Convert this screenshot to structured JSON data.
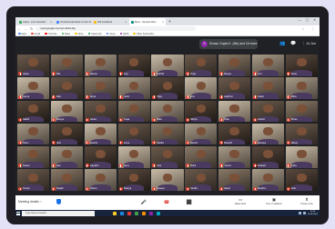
{
  "browser": {
    "tabs": [
      {
        "title": "Lafiya - Link Guardian",
        "favicon_color": "#34a853",
        "active": false
      },
      {
        "title": "Vivekananda Matric Hr.Sec.Sch",
        "favicon_color": "#4285f4",
        "active": false
      },
      {
        "title": "AW Feedback",
        "favicon_color": "#fbbc04",
        "active": false
      },
      {
        "title": "Meet - Sample Meet",
        "favicon_color": "#00897b",
        "active": true
      }
    ],
    "new_tab": "+",
    "window_controls": "— ▢ ✕",
    "url": "meet.google.com/xyz-abcd-efg",
    "nav": {
      "back": "←",
      "forward": "→",
      "reload": "↻"
    },
    "toolbar_icons": "☆ ⋮",
    "bookmarks": [
      {
        "label": "Apps",
        "color": "#4285f4"
      },
      {
        "label": "Gmail",
        "color": "#ea4335"
      },
      {
        "label": "YouTube",
        "color": "#ff0000"
      },
      {
        "label": "Maps",
        "color": "#34a853"
      },
      {
        "label": "Drive",
        "color": "#fbbc04"
      },
      {
        "label": "Classroom",
        "color": "#0f9d58"
      },
      {
        "label": "News",
        "color": "#4285f4"
      },
      {
        "label": "EMIS",
        "color": "#9c27b0"
      },
      {
        "label": "Other bookmarks",
        "color": "#fbbc04"
      }
    ]
  },
  "meet": {
    "pinned": {
      "initial": "S",
      "name": "Sivasu Gupta K. (Me) and 16 more"
    },
    "top_icons": {
      "people": "👥",
      "chat": "💬",
      "count": "⋮ 14 Jun"
    },
    "participants": [
      "Aarav",
      "Nila",
      "Meena",
      "Riya",
      "Karthik",
      "Priya",
      "Deepa",
      "Arun",
      "Sona",
      "Kavya",
      "Ravi",
      "Divya",
      "Harini",
      "Vijay",
      "Anu",
      "Lakshmi",
      "Gokul",
      "Mitra",
      "Sakthi",
      "Ramya",
      "Janani",
      "Pooja",
      "Bala",
      "Nithya",
      "Kiran",
      "Ashwin",
      "Shree",
      "Tarun",
      "Vani",
      "Keerthi",
      "Surya",
      "Madhu",
      "Dinesh",
      "Revathi",
      "Abinaya",
      "Manoj",
      "Sneha",
      "Hari",
      "Gayathri",
      "Varun",
      "Isha",
      "Rohit",
      "Yamini",
      "Prakash",
      "Asha",
      "Kumar",
      "Swathi",
      "Vishnu",
      "Bhavya",
      "Naveen",
      "Sindhu",
      "Akash",
      "Pavithra",
      "Selvi"
    ],
    "meeting_details": "Meeting details",
    "controls": {
      "mic": "🎤",
      "end": "☎",
      "camera": "⬛"
    },
    "actions": [
      {
        "icon": "▭",
        "label": "Raise hand"
      },
      {
        "icon": "▣",
        "label": "Turn on captions"
      },
      {
        "icon": "⬆",
        "label": "Present now"
      }
    ]
  },
  "taskbar": {
    "search_placeholder": "Type here to search",
    "apps": [
      "#ffca28",
      "#1e88e5",
      "#e53935",
      "#43a047",
      "#fb8c00",
      "#8e24aa",
      "#00acc1"
    ],
    "time": "11:24",
    "date": "14-06-2021"
  }
}
